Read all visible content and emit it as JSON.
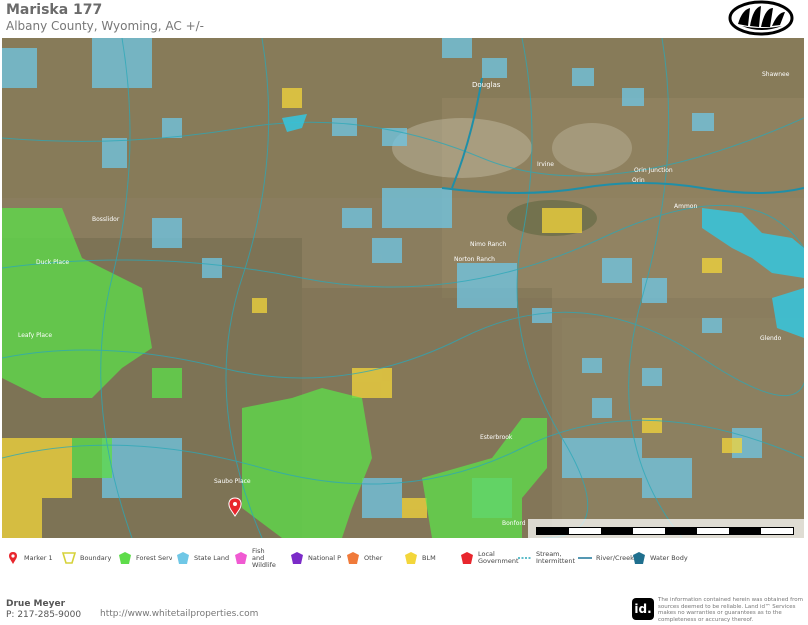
{
  "header": {
    "title": "Mariska 177",
    "subtitle": "Albany County, Wyoming,  AC +/-"
  },
  "map": {
    "place_labels": [
      {
        "name": "Douglas"
      },
      {
        "name": "Shawnee"
      },
      {
        "name": "Orin Junction"
      },
      {
        "name": "Irvine"
      },
      {
        "name": "Orin"
      },
      {
        "name": "Bosslidor"
      },
      {
        "name": "Duck Place"
      },
      {
        "name": "Ammon"
      },
      {
        "name": "Nimo Ranch"
      },
      {
        "name": "Norton Ranch"
      },
      {
        "name": "Leafy Place"
      },
      {
        "name": "Glendo"
      },
      {
        "name": "Esterbrook"
      },
      {
        "name": "Bonford"
      },
      {
        "name": "Saubo Place"
      }
    ],
    "colors": {
      "forest_service": "#5edc4a",
      "state_land": "#6fc7e6",
      "blm": "#f3d63b",
      "water_body": "#38c2d8",
      "stream": "#2aa8b8"
    }
  },
  "scale": {
    "labels": [
      "0",
      "20000",
      "40000",
      "60000",
      "80000ft"
    ]
  },
  "legend": [
    {
      "label": "Marker 1",
      "icon": "marker-icon",
      "color": "#e8262d"
    },
    {
      "label": "Boundary",
      "icon": "boundary-icon",
      "color": "#e6e65a"
    },
    {
      "label": "Forest Service",
      "icon": "polygon-icon",
      "color": "#5edc4a"
    },
    {
      "label": "State Land",
      "icon": "polygon-icon",
      "color": "#6fc7e6"
    },
    {
      "label": "Fish and Wildlife",
      "icon": "polygon-icon",
      "color": "#f05ad2"
    },
    {
      "label": "National Park",
      "icon": "polygon-icon",
      "color": "#7b2bc8"
    },
    {
      "label": "Other",
      "icon": "polygon-icon",
      "color": "#f07a3a"
    },
    {
      "label": "BLM",
      "icon": "polygon-icon",
      "color": "#f3d63b"
    },
    {
      "label": "Local Government",
      "icon": "polygon-icon",
      "color": "#e8262d"
    },
    {
      "label": "Stream, Intermittent",
      "icon": "dashed-line-icon",
      "color": "#2aa8b8"
    },
    {
      "label": "River/Creek",
      "icon": "line-icon",
      "color": "#2a7fa0"
    },
    {
      "label": "Water Body",
      "icon": "polygon-icon",
      "color": "#1f6f8e"
    }
  ],
  "footer": {
    "agent_name": "Drue Meyer",
    "agent_phone": "P: 217-285-9000",
    "website": "http://www.whitetailproperties.com",
    "id_logo": "id.",
    "disclaimer": "The information contained herein was obtained from sources deemed to be reliable. Land id™ Services makes no warranties or guarantees as to the completeness or accuracy thereof."
  }
}
